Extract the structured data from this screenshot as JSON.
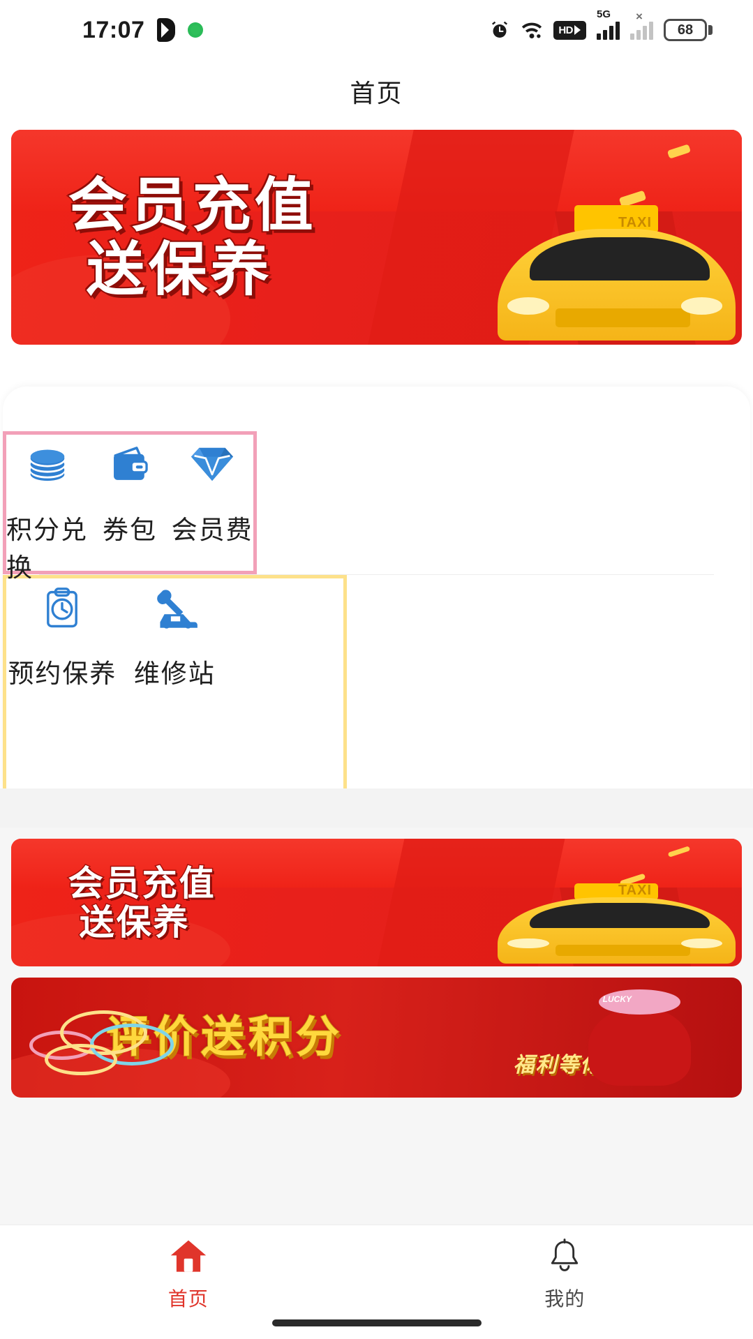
{
  "status_bar": {
    "time": "17:07",
    "icons": [
      "play-badge-icon",
      "green-dot-icon",
      "alarm-icon",
      "wifi-icon",
      "hd-voice-icon",
      "signal-5g-icon",
      "signal-no-service-icon"
    ],
    "network_label": "5G",
    "hd_label": "HD",
    "no_service_mark": "×",
    "battery_level": "68"
  },
  "header": {
    "title": "首页"
  },
  "hero_banner": {
    "name": "member-recharge-banner",
    "line1": "会员充值",
    "line2": "送保养",
    "taxi_label": "TAXI",
    "bg_color": "#e8201b"
  },
  "menu": {
    "rows": [
      [
        {
          "label": "积分兑换",
          "icon": "coins-stack-icon"
        },
        {
          "label": "券包",
          "icon": "wallet-icon"
        },
        {
          "label": "会员费",
          "icon": "diamond-icon"
        }
      ],
      [
        {
          "label": "预约保养",
          "icon": "clipboard-clock-icon"
        },
        {
          "label": "维修站",
          "icon": "wrench-car-icon"
        }
      ]
    ],
    "icon_color": "#2f80d2"
  },
  "promos": [
    {
      "name": "member-recharge-promo",
      "type": "red",
      "line1": "会员充值",
      "line2": "送保养",
      "taxi_label": "TAXI"
    },
    {
      "name": "review-points-promo",
      "type": "gold",
      "title": "评价送积分",
      "subtitle": "福利等你拿",
      "badge_label": "LUCKY"
    }
  ],
  "tabbar": {
    "items": [
      {
        "label": "首页",
        "icon": "home-icon",
        "active": true,
        "color": "#e0352b"
      },
      {
        "label": "我的",
        "icon": "bell-icon",
        "active": false,
        "color": "#4a4a4a"
      }
    ]
  }
}
